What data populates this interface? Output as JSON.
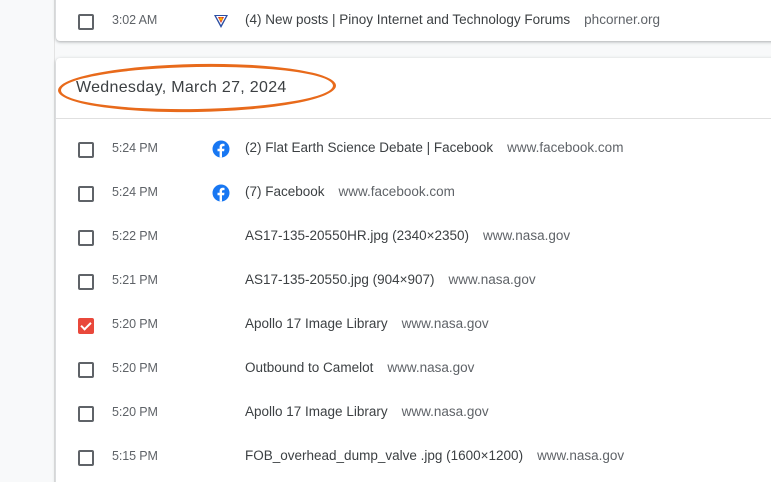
{
  "top_entry": {
    "time": "3:02 AM",
    "title": "(4) New posts | Pinoy Internet and Technology Forums",
    "domain": "phcorner.org",
    "icon": "phcorner-favicon-icon",
    "checked": false
  },
  "date_header": "Wednesday, March 27, 2024",
  "annotation_color": "#e86a1b",
  "entries": [
    {
      "time": "5:24 PM",
      "title": "(2) Flat Earth Science Debate | Facebook",
      "domain": "www.facebook.com",
      "icon": "facebook-icon",
      "checked": false
    },
    {
      "time": "5:24 PM",
      "title": "(7) Facebook",
      "domain": "www.facebook.com",
      "icon": "facebook-icon",
      "checked": false
    },
    {
      "time": "5:22 PM",
      "title": "AS17-135-20550HR.jpg (2340×2350)",
      "domain": "www.nasa.gov",
      "icon": "",
      "checked": false
    },
    {
      "time": "5:21 PM",
      "title": "AS17-135-20550.jpg (904×907)",
      "domain": "www.nasa.gov",
      "icon": "",
      "checked": false
    },
    {
      "time": "5:20 PM",
      "title": "Apollo 17 Image Library",
      "domain": "www.nasa.gov",
      "icon": "",
      "checked": true
    },
    {
      "time": "5:20 PM",
      "title": "Outbound to Camelot",
      "domain": "www.nasa.gov",
      "icon": "",
      "checked": false
    },
    {
      "time": "5:20 PM",
      "title": "Apollo 17 Image Library",
      "domain": "www.nasa.gov",
      "icon": "",
      "checked": false
    },
    {
      "time": "5:15 PM",
      "title": "FOB_overhead_dump_valve .jpg (1600×1200)",
      "domain": "www.nasa.gov",
      "icon": "",
      "checked": false
    }
  ],
  "colors": {
    "checkbox_checked": "#e9483b",
    "facebook_blue": "#1877f2"
  }
}
